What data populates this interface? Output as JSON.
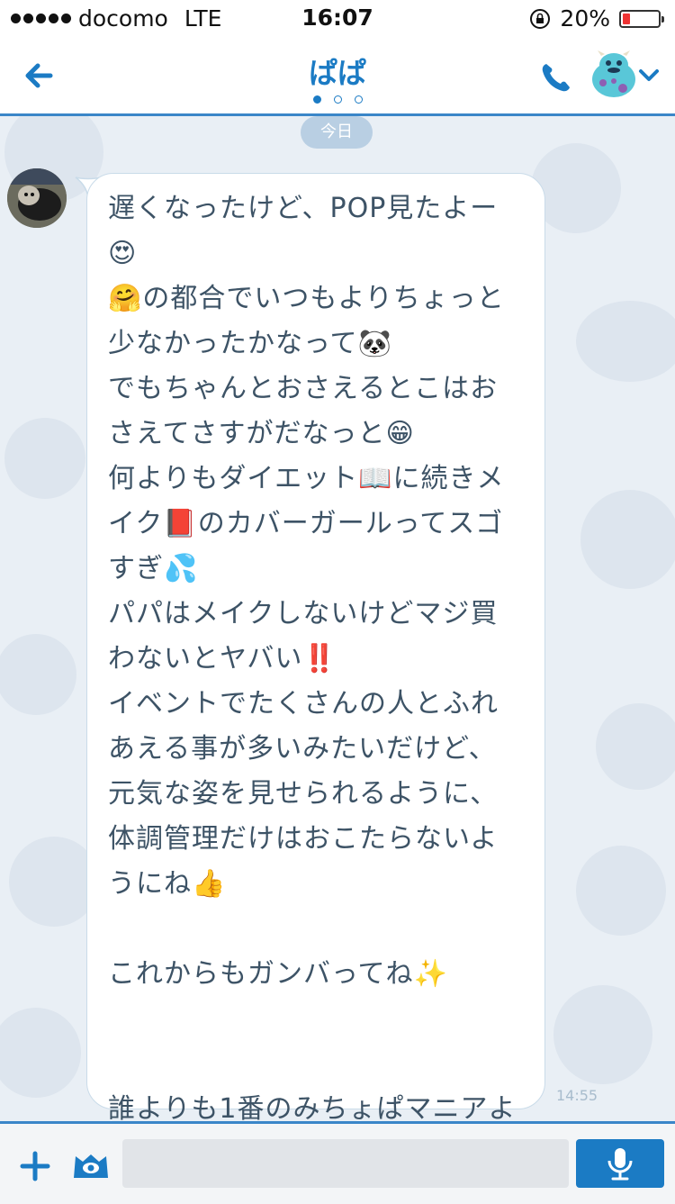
{
  "status_bar": {
    "carrier": "docomo",
    "network": "LTE",
    "time": "16:07",
    "battery_percent_text": "20%",
    "battery_level": 0.2,
    "signal_icon": "signal-dots-icon",
    "lock_icon": "rotation-lock-icon"
  },
  "header": {
    "title": "ぱぱ",
    "page_indicator": {
      "count": 3,
      "active": 0
    },
    "icons": [
      "back-arrow-icon",
      "phone-icon",
      "character-avatar-icon",
      "chevron-down-icon"
    ],
    "accent_color": "#1b7bc4"
  },
  "chat": {
    "date_label": "今日",
    "message": {
      "text_parts": [
        {
          "t": "遅くなったけど、POP見たよー\n",
          "type": "text"
        },
        {
          "t": "😍",
          "type": "emoji"
        },
        {
          "t": "\n",
          "type": "text"
        },
        {
          "t": "🤗",
          "type": "emoji"
        },
        {
          "t": "の都合でいつもよりちょっと少なかったかなって",
          "type": "text"
        },
        {
          "t": "🐼",
          "type": "emoji"
        },
        {
          "t": "\nでもちゃんとおさえるとこはおさえてさすがだなっと",
          "type": "text"
        },
        {
          "t": "😁",
          "type": "emoji"
        },
        {
          "t": "\n何よりもダイエット",
          "type": "text"
        },
        {
          "t": "📖",
          "type": "emoji"
        },
        {
          "t": "に続きメイク",
          "type": "text"
        },
        {
          "t": "📕",
          "type": "emoji"
        },
        {
          "t": "のカバーガールってスゴすぎ",
          "type": "text"
        },
        {
          "t": "💦",
          "type": "emoji"
        },
        {
          "t": "\nパパはメイクしないけどマジ買わないとヤバい",
          "type": "text"
        },
        {
          "t": "‼️",
          "type": "emoji"
        },
        {
          "t": "\nイベントでたくさんの人とふれあえる事が多いみたいだけど、元気な姿を見せられるように、体調管理だけはおこたらないようにね",
          "type": "text"
        },
        {
          "t": "👍",
          "type": "emoji"
        },
        {
          "t": "\n\nこれからもガンバってね",
          "type": "text"
        },
        {
          "t": "✨",
          "type": "emoji"
        },
        {
          "t": "\n\n\n誰よりも1番のみちょぱマニアより",
          "type": "text"
        },
        {
          "t": "💖",
          "type": "emoji"
        }
      ],
      "time": "14:55"
    }
  },
  "input_bar": {
    "icons": [
      "plus-icon",
      "eye-sticker-icon",
      "microphone-icon"
    ],
    "placeholder": ""
  }
}
